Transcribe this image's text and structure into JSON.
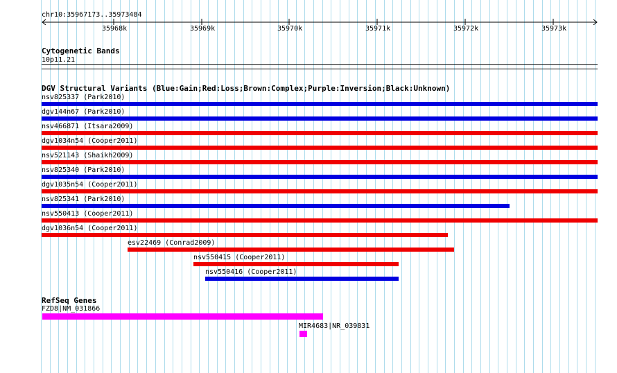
{
  "ruler": {
    "label": "chr10:35967173..35973484",
    "ticks": [
      "35968k",
      "35969k",
      "35970k",
      "35971k",
      "35972k",
      "35973k"
    ]
  },
  "cytoband": {
    "title": "Cytogenetic Bands",
    "band": "10p11.21"
  },
  "dgv": {
    "title": "DGV Structural Variants (Blue:Gain;Red:Loss;Brown:Complex;Purple:Inversion;Black:Unknown)",
    "items": [
      {
        "label": "nsv825337 (Park2010)",
        "type": "gain",
        "color": "#0000e0"
      },
      {
        "label": "dgv144n67 (Park2010)",
        "type": "gain",
        "color": "#0000e0"
      },
      {
        "label": "nsv466871 (Itsara2009)",
        "type": "loss",
        "color": "#ef0000"
      },
      {
        "label": "dgv1034n54 (Cooper2011)",
        "type": "loss",
        "color": "#ef0000"
      },
      {
        "label": "nsv521143 (Shaikh2009)",
        "type": "loss",
        "color": "#ef0000"
      },
      {
        "label": "nsv825340 (Park2010)",
        "type": "gain",
        "color": "#0000e0"
      },
      {
        "label": "dgv1035n54 (Cooper2011)",
        "type": "loss",
        "color": "#ef0000"
      },
      {
        "label": "nsv825341 (Park2010)",
        "type": "gain",
        "color": "#0000e0"
      },
      {
        "label": "nsv550413 (Cooper2011)",
        "type": "loss",
        "color": "#ef0000"
      },
      {
        "label": "dgv1036n54 (Cooper2011)",
        "type": "loss",
        "color": "#ef0000"
      },
      {
        "label": "esv22469 (Conrad2009)",
        "type": "loss",
        "color": "#ef0000"
      },
      {
        "label": "nsv550415 (Cooper2011)",
        "type": "loss",
        "color": "#ef0000"
      },
      {
        "label": "nsv550416 (Cooper2011)",
        "type": "gain",
        "color": "#0000e0"
      }
    ]
  },
  "refseq": {
    "title": "RefSeq Genes",
    "genes": [
      {
        "label": "FZD8|NM_031866",
        "color": "#ff00ff"
      },
      {
        "label": "MIR4683|NR_039831",
        "color": "#ff00ff"
      }
    ]
  },
  "colors": {
    "grid": "#aedcec",
    "gain": "#0000e0",
    "loss": "#ef0000",
    "gene": "#ff00ff"
  }
}
